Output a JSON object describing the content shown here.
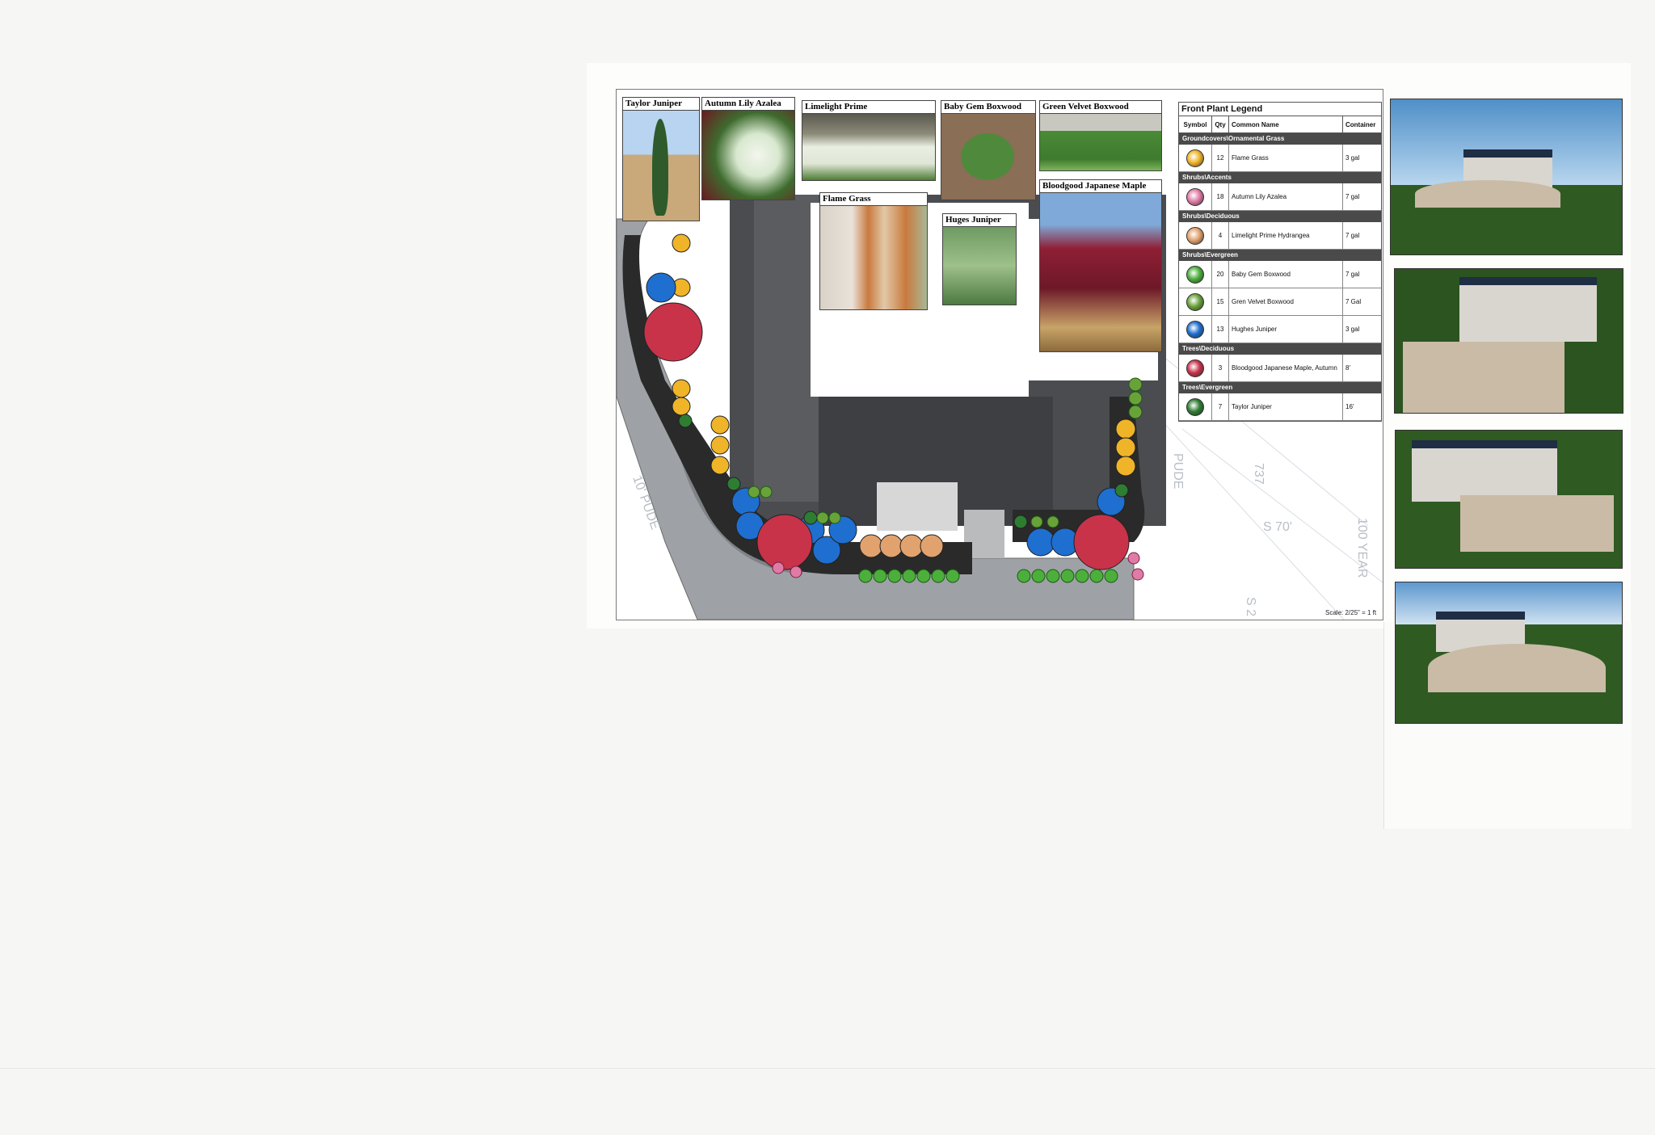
{
  "plant_photos": [
    {
      "label": "Taylor Juniper",
      "color": "#3f6b34"
    },
    {
      "label": "Autumn Lily Azalea",
      "color": "#e9efe4"
    },
    {
      "label": "Limelight Prime",
      "color": "#dfe6d6"
    },
    {
      "label": "Baby Gem Boxwood",
      "color": "#4f8a3c"
    },
    {
      "label": "Green Velvet Boxwood",
      "color": "#4a8b36"
    },
    {
      "label": "Flame Grass",
      "color": "#c97a3e"
    },
    {
      "label": "Huges Juniper",
      "color": "#6e9a62"
    },
    {
      "label": "Bloodgood Japanese Maple",
      "color": "#8f1f34"
    }
  ],
  "legend": {
    "title": "Front Plant Legend",
    "headers": {
      "symbol": "Symbol",
      "qty": "Qty",
      "name": "Common Name",
      "container": "Container"
    },
    "groups": [
      {
        "category": "Groundcovers\\Ornamental Grass",
        "items": [
          {
            "qty": "12",
            "name": "Flame Grass",
            "container": "3 gal",
            "color": "#f0b429"
          }
        ]
      },
      {
        "category": "Shrubs\\Accents",
        "items": [
          {
            "qty": "18",
            "name": "Autumn Lily Azalea",
            "container": "7 gal",
            "color": "#e07ba6"
          }
        ]
      },
      {
        "category": "Shrubs\\Deciduous",
        "items": [
          {
            "qty": "4",
            "name": "Limelight Prime Hydrangea",
            "container": "7 gal",
            "color": "#e2a26e"
          }
        ]
      },
      {
        "category": "Shrubs\\Evergreen",
        "items": [
          {
            "qty": "20",
            "name": "Baby Gem Boxwood",
            "container": "7 gal",
            "color": "#4caf3c"
          },
          {
            "qty": "15",
            "name": "Gren Velvet Boxwood",
            "container": "7 Gal",
            "color": "#6aa23a"
          },
          {
            "qty": "13",
            "name": "Hughes Juniper",
            "container": "3 gal",
            "color": "#1e6fd0"
          }
        ]
      },
      {
        "category": "Trees\\Deciduous",
        "items": [
          {
            "qty": "3",
            "name": "Bloodgood Japanese Maple, Autumn",
            "container": "8'",
            "color": "#c8334a"
          }
        ]
      },
      {
        "category": "Trees\\Evergreen",
        "items": [
          {
            "qty": "7",
            "name": "Taylor Juniper",
            "container": "16'",
            "color": "#2e7d32"
          }
        ]
      }
    ]
  },
  "scale": "Scale: 2/25\" = 1 ft",
  "plan_text": [
    "10' PUDE",
    "PUDE",
    "100 YEAR",
    "737",
    "S 70'",
    "S 2"
  ],
  "renders": [
    {
      "view": "front"
    },
    {
      "view": "corner"
    },
    {
      "view": "side"
    },
    {
      "view": "distant"
    }
  ]
}
